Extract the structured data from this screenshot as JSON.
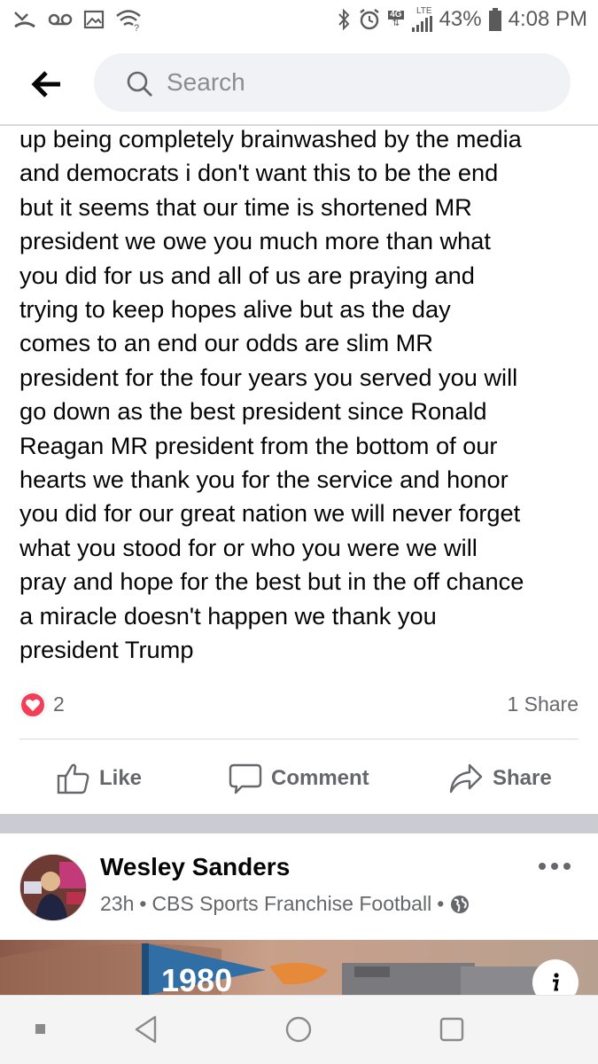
{
  "status_bar": {
    "network_tag": "4G",
    "lte_tag": "LTE",
    "battery": "43%",
    "time": "4:08 PM"
  },
  "search": {
    "placeholder": "Search"
  },
  "post": {
    "body": "up being completely brainwashed by the media\nand democrats i don't want this to be the end\nbut it seems that our time is shortened MR\npresident we owe you much more than what\nyou did for us and all of us are praying and\ntrying to keep hopes alive but as the day\ncomes to an end our odds are slim MR\npresident for the four years you served you will\ngo down as the best president since Ronald\nReagan MR president from the bottom of our\nhearts we thank you for the service and honor\nyou did for our great nation we will never forget\nwhat you stood for or who you were we will\npray and hope for the best but in the off chance\na miracle doesn't happen we thank you\npresident Trump",
    "reaction_count": "2",
    "share_count": "1 Share",
    "actions": {
      "like": "Like",
      "comment": "Comment",
      "share": "Share"
    }
  },
  "next_post": {
    "author": "Wesley Sanders",
    "time": "23h",
    "separator": "•",
    "source": "CBS Sports Franchise Football",
    "image_text": "1980"
  },
  "colors": {
    "reaction_heart": "#f33e58",
    "action_gray": "#65676b",
    "band_gray": "#c9ccd1"
  },
  "icons": [
    "back-arrow-icon",
    "search-icon",
    "heart-icon",
    "like-icon",
    "comment-icon",
    "share-icon",
    "more-icon",
    "globe-icon",
    "info-icon",
    "nav-back-icon",
    "nav-home-icon",
    "nav-recents-icon"
  ]
}
